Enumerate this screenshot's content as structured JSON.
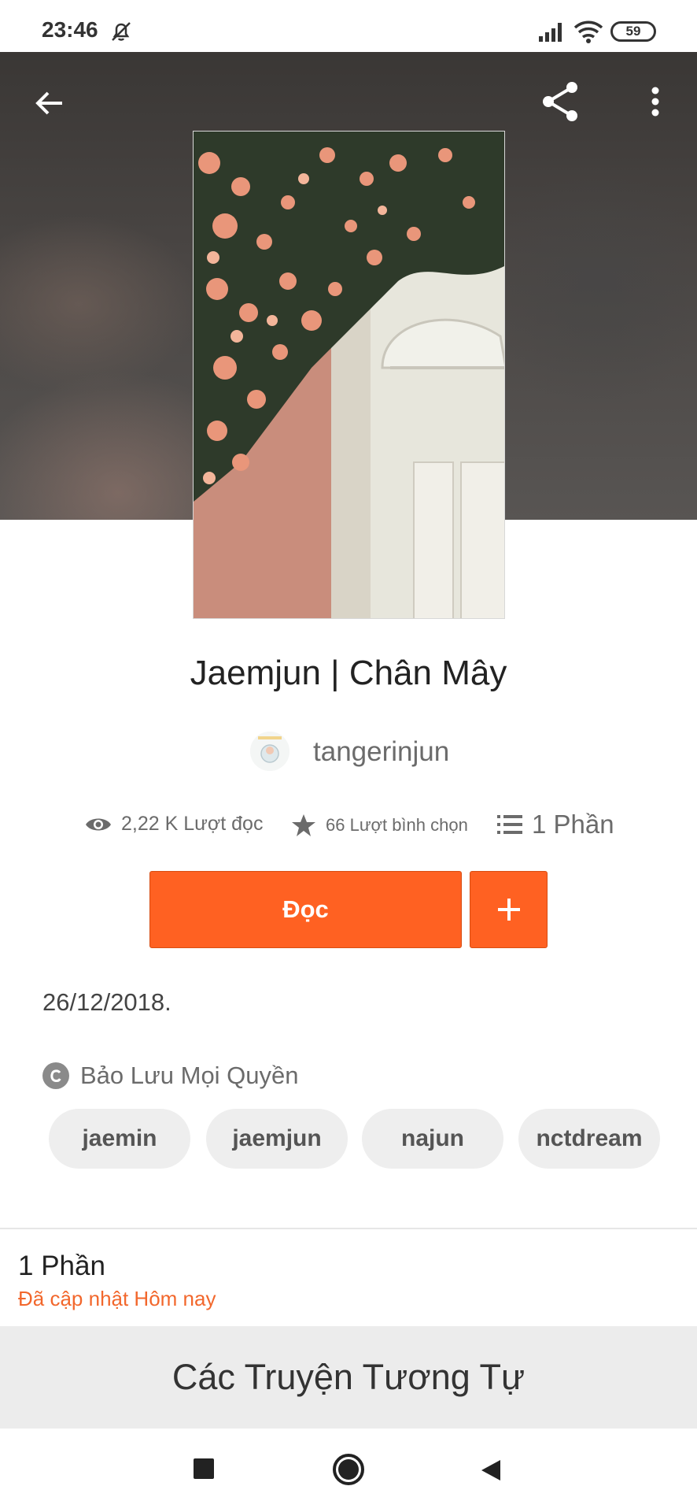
{
  "status_bar": {
    "time": "23:46",
    "battery": "59",
    "icons": [
      "bell-off-icon",
      "signal-icon",
      "wifi-icon",
      "battery-icon"
    ]
  },
  "toolbar": {
    "icons": [
      "back-arrow-icon",
      "share-icon",
      "more-vertical-icon"
    ]
  },
  "story": {
    "title": "Jaemjun | Chân Mây",
    "author": "tangerinjun",
    "stats": {
      "reads": "2,22 K Lượt đọc",
      "votes": "66 Lượt bình chọn",
      "parts": "1 Phần"
    },
    "read_button": "Đọc",
    "add_button_icon": "plus-icon",
    "description": "26/12/2018.",
    "copyright": "Bảo Lưu Mọi Quyền",
    "tags": [
      "jaemin",
      "jaemjun",
      "najun",
      "nctdream"
    ]
  },
  "parts_section": {
    "title": "1 Phần",
    "updated": "Đã cập nhật Hôm nay"
  },
  "similar": {
    "title": "Các Truyện Tương Tự"
  },
  "nav_bar": {
    "icons": [
      "recents-square-icon",
      "home-circle-icon",
      "back-triangle-icon"
    ]
  },
  "colors": {
    "accent": "#ff6122",
    "update_text": "#f2672c",
    "tag_bg": "#eeeeee",
    "section_bg": "#ececec"
  }
}
